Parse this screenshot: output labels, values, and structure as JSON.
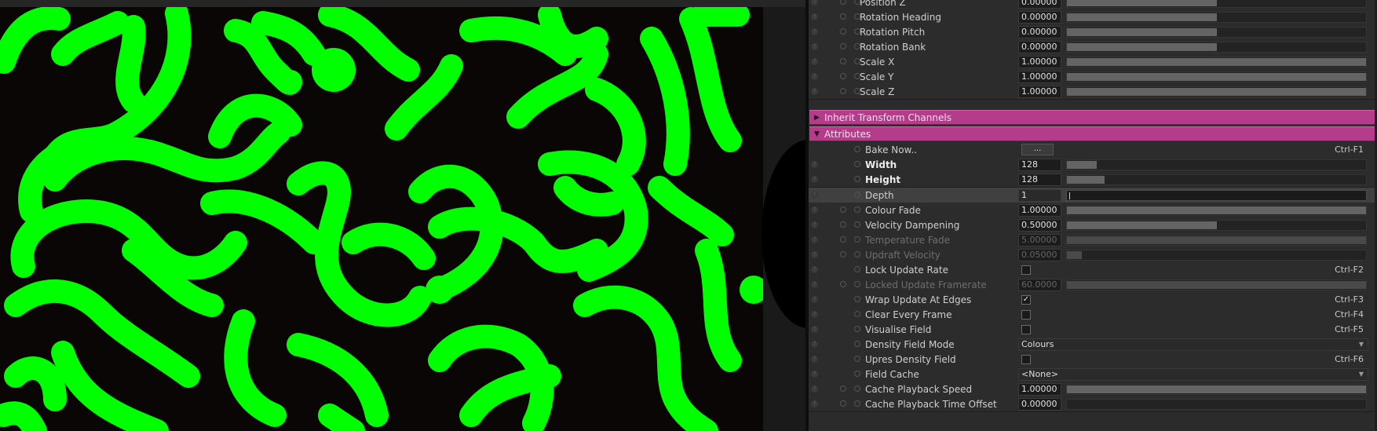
{
  "viewport": {
    "description_color": "#00ff00"
  },
  "panel": {
    "transform_rows": [
      {
        "label": "Position Z",
        "value": "0.00000",
        "fill": 0.5
      },
      {
        "label": "Rotation Heading",
        "value": "0.00000",
        "fill": 0.5
      },
      {
        "label": "Rotation Pitch",
        "value": "0.00000",
        "fill": 0.5
      },
      {
        "label": "Rotation Bank",
        "value": "0.00000",
        "fill": 0.5
      },
      {
        "label": "Scale X",
        "value": "1.00000",
        "fill": 1.0
      },
      {
        "label": "Scale Y",
        "value": "1.00000",
        "fill": 1.0
      },
      {
        "label": "Scale Z",
        "value": "1.00000",
        "fill": 1.0
      }
    ],
    "section_inherit": {
      "title": "Inherit Transform Channels",
      "expanded": false
    },
    "section_attributes": {
      "title": "Attributes",
      "expanded": true
    },
    "attributes": {
      "bake": {
        "label": "Bake Now..",
        "button": "...",
        "shortcut": "Ctrl-F1"
      },
      "width": {
        "label": "Width",
        "value": "128",
        "fill": 0.1
      },
      "height": {
        "label": "Height",
        "value": "128",
        "fill": 0.125
      },
      "depth": {
        "label": "Depth",
        "value": "1"
      },
      "colour_fade": {
        "label": "Colour Fade",
        "value": "1.00000",
        "fill": 1.0
      },
      "velocity_dampening": {
        "label": "Velocity Dampening",
        "value": "0.50000",
        "fill": 0.5
      },
      "temperature_fade": {
        "label": "Temperature Fade",
        "value": "5.00000",
        "fill": 1.0
      },
      "updraft_velocity": {
        "label": "Updraft Velocity",
        "value": "0.05000",
        "fill": 0.05
      },
      "lock_update_rate": {
        "label": "Lock Update Rate",
        "checked": false,
        "shortcut": "Ctrl-F2"
      },
      "locked_update_framerate": {
        "label": "Locked Update Framerate",
        "value": "60.0000",
        "fill": 1.0
      },
      "wrap_update": {
        "label": "Wrap Update At Edges",
        "checked": true,
        "check_glyph": "✓",
        "shortcut": "Ctrl-F3"
      },
      "clear_every_frame": {
        "label": "Clear Every Frame",
        "checked": false,
        "shortcut": "Ctrl-F4"
      },
      "visualise_field": {
        "label": "Visualise Field",
        "checked": false,
        "shortcut": "Ctrl-F5"
      },
      "density_field_mode": {
        "label": "Density Field Mode",
        "value": "Colours"
      },
      "upres_density_field": {
        "label": "Upres Density Field",
        "checked": false,
        "shortcut": "Ctrl-F6"
      },
      "field_cache": {
        "label": "Field Cache",
        "value": "<None>"
      },
      "cache_playback_speed": {
        "label": "Cache Playback Speed",
        "value": "1.00000",
        "fill": 1.0
      },
      "cache_playback_time_offset": {
        "label": "Cache Playback Time Offset",
        "value": "0.00000",
        "fill": 0.0
      }
    },
    "icons": {
      "help": "?",
      "arrow_collapsed": "▶",
      "arrow_expanded": "▼",
      "dropdown": "▼"
    }
  }
}
